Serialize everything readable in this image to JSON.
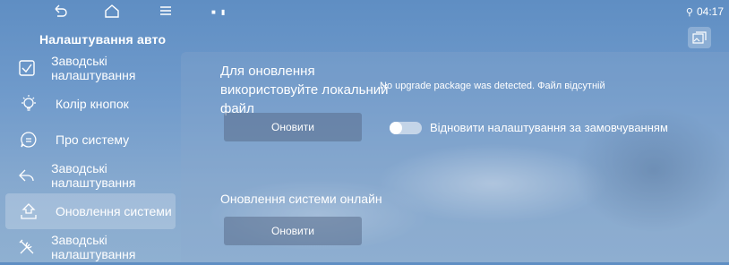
{
  "status_bar": {
    "time": "04:17",
    "notification_indicators": "■ ▮",
    "location_glyph": "⚲",
    "nav_icons": [
      "back-icon",
      "home-icon",
      "menu-icon"
    ]
  },
  "sidebar": {
    "title": "Налаштування авто",
    "items": [
      {
        "label": "Заводські налаштування",
        "icon": "checkbox-icon"
      },
      {
        "label": "Колір кнопок",
        "icon": "lightbulb-icon"
      },
      {
        "label": "Про систему",
        "icon": "message-icon"
      },
      {
        "label": "Заводські налаштування",
        "icon": "back-arrow-icon"
      },
      {
        "label": "Оновлення системи",
        "icon": "upload-icon",
        "active": true
      },
      {
        "label": "Заводські налаштування",
        "icon": "tools-icon"
      }
    ]
  },
  "main": {
    "local_update_title": "Для оновлення використовуйте локальний файл",
    "no_upgrade_message": "No upgrade package was detected. Файл відсутній",
    "update_button_label": "Оновити",
    "restore_default_label": "Відновити налаштування за замовчуванням",
    "restore_default_enabled": false,
    "online_update_title": "Оновлення системи онлайн",
    "online_update_button_label": "Оновити",
    "gallery_icon": "gallery-icon"
  },
  "colors": {
    "background_top": "#5f8ec3",
    "background_bottom": "#8fb0d1",
    "text": "#ffffff"
  }
}
